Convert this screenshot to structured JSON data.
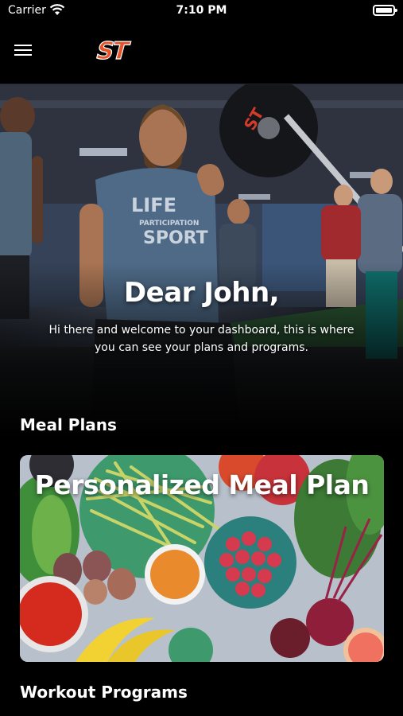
{
  "status_bar": {
    "carrier": "Carrier",
    "time": "7:10 PM"
  },
  "nav": {
    "logo_text": "ST",
    "brand_color": "#e8542a"
  },
  "hero": {
    "greeting": "Dear John,",
    "welcome_text": "Hi there and welcome to your dashboard, this is where you can see your plans and programs.",
    "shirt_text": [
      "LIFE",
      "PARTICIPATION",
      "SPORT"
    ],
    "plate_text": "ST"
  },
  "sections": {
    "meal_plans": "Meal Plans",
    "workout_programs": "Workout Programs"
  },
  "meal_card": {
    "title": "Personalized Meal Plan"
  }
}
